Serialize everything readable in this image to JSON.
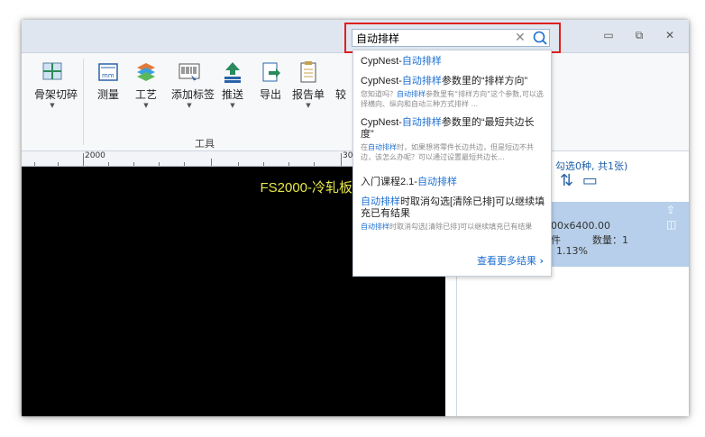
{
  "search": {
    "query": "自动排样"
  },
  "results": [
    {
      "title_pre": "CypNest-",
      "title_hl": "自动排样",
      "title_post": "",
      "desc_hl": "",
      "desc_post": ""
    },
    {
      "title_pre": "CypNest-",
      "title_hl": "自动排样",
      "title_post": "参数里的“排样方向”",
      "desc_pre": "您知道吗？",
      "desc_hl": "自动排样",
      "desc_post": "参数里有“排样方向”这个参数,可以选择横向、纵向和自动三种方式排样 ..."
    },
    {
      "title_pre": "CypNest-",
      "title_hl": "自动排样",
      "title_post": "参数里的“最短共边长度”",
      "desc_pre": "在",
      "desc_hl": "自动排样",
      "desc_post": "时，如果想将零件长边共边，但是短边不共边，该怎么办呢？可以通过设置最短共边长..."
    },
    {
      "title_pre": "入门课程2.1-",
      "title_hl": "自动排样",
      "title_post": "",
      "desc_hl": "",
      "desc_post": ""
    },
    {
      "title_pre": "",
      "title_hl": "自动排样",
      "title_post": "时取消勾选[清除已排]可以继续填充已有结果",
      "desc_pre": "",
      "desc_hl": "自动排样",
      "desc_post": "时取消勾选[清除已排]可以继续填充已有结果"
    }
  ],
  "more_results": "查看更多结果",
  "ribbon": {
    "tools": [
      {
        "label": "骨架切碎"
      },
      {
        "label": "测量"
      },
      {
        "label": "工艺"
      },
      {
        "label": "添加标签"
      },
      {
        "label": "推送"
      },
      {
        "label": "导出"
      },
      {
        "label": "报告单"
      },
      {
        "label": "较"
      }
    ],
    "group_label": "工具"
  },
  "ruler": {
    "left_label": "2000",
    "right_label": "30"
  },
  "canvas": {
    "title": "FS2000-冷轧板-"
  },
  "right_panel": {
    "summary": "，勾选0种, 共1张)",
    "sheet_size": "00x6400.00",
    "parts_label": "件",
    "quantity": "数量：1",
    "usage": "1.13%"
  },
  "colors": {
    "accent": "#1c6fd1",
    "highlight_border": "#e02020",
    "canvas_text": "#e8e84a"
  }
}
